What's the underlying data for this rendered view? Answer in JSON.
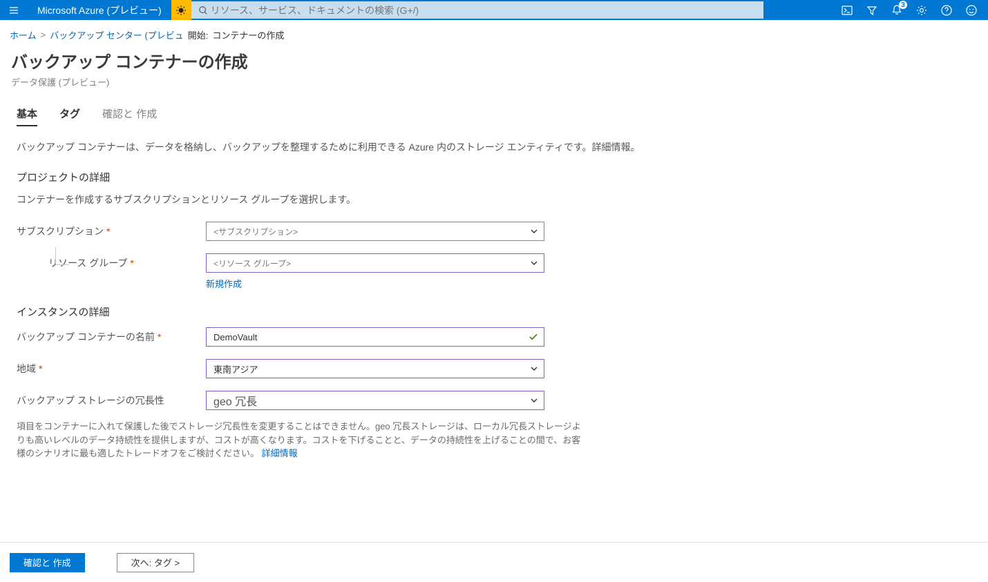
{
  "brand": "Microsoft Azure (プレビュー)",
  "search": {
    "placeholder": "リソース、サービス、ドキュメントの検索 (G+/)"
  },
  "notifications_count": "3",
  "breadcrumb": {
    "home": "ホーム",
    "sep1": ">",
    "backup_center": "バックアップ センター (プレビュ",
    "start_label": "開始:",
    "current": "コンテナーの作成"
  },
  "page": {
    "title": "バックアップ コンテナーの作成",
    "subtitle": "データ保護 (プレビュー)"
  },
  "tabs": {
    "basic": "基本",
    "tags": "タグ",
    "review": "確認と 作成"
  },
  "description": "バックアップ コンテナーは、データを格納し、バックアップを整理するために利用できる Azure 内のストレージ エンティティです。詳細情報。",
  "project": {
    "title": "プロジェクトの詳細",
    "desc": "コンテナーを作成するサブスクリプションとリソース グループを選択します。"
  },
  "form": {
    "subscription_label": "サブスクリプション",
    "subscription_value": "<サブスクリプション>",
    "resource_group_label": "リソース グループ",
    "resource_group_value": "<リソース グループ>",
    "create_new": "新規作成",
    "instance_title": "インスタンスの詳細",
    "vault_name_label": "バックアップ コンテナーの名前",
    "vault_name_value": "DemoVault",
    "region_label": "地域",
    "region_value": "東南アジア",
    "redundancy_label": "バックアップ ストレージの冗長性",
    "redundancy_value": "geo 冗長"
  },
  "storage_note": "項目をコンテナーに入れて保護した後でストレージ冗長性を変更することはできません。geo 冗長ストレージは、ローカル冗長ストレージよりも高いレベルのデータ持続性を提供しますが、コストが高くなります。コストを下げることと、データの持続性を上げることの間で、お客様のシナリオに最も適したトレードオフをご検討ください。",
  "storage_note_link": "詳細情報",
  "footer": {
    "review_create": "確認と 作成",
    "next": "次へ: タグ >"
  }
}
